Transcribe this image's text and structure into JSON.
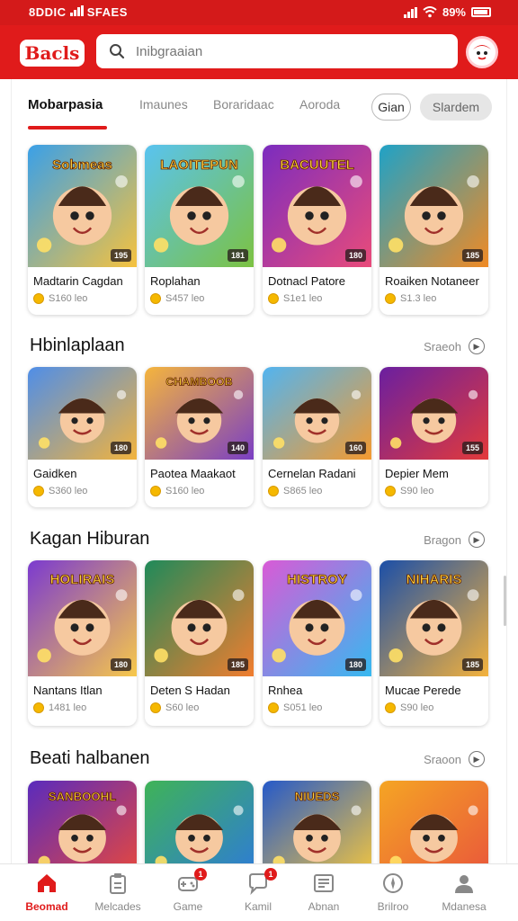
{
  "status_bar": {
    "left_text": "8DDIC",
    "carrier": "SFAES",
    "battery": "89%"
  },
  "app": {
    "logo": "Bacls",
    "search_placeholder": "Inibgraaian"
  },
  "tabs": [
    {
      "label": "Mobarpasia",
      "active": true
    },
    {
      "label": "Imaunes"
    },
    {
      "label": "Boraridaac"
    },
    {
      "label": "Aoroda"
    }
  ],
  "pills": [
    {
      "label": "Gian"
    },
    {
      "label": "Slardem"
    }
  ],
  "featured": {
    "cards": [
      {
        "title": "Madtarin Cagdan",
        "meta": "S160 leo",
        "badge": "195",
        "banner": "Sobmeas",
        "colors": [
          "#3aa0e8",
          "#f6c23e"
        ]
      },
      {
        "title": "Roplahan",
        "meta": "S457 leo",
        "badge": "181",
        "banner": "LAOITEPUN",
        "colors": [
          "#59c3f0",
          "#7cc242"
        ]
      },
      {
        "title": "Dotnacl Patore",
        "meta": "S1e1 leo",
        "badge": "180",
        "banner": "BACUUTEL",
        "colors": [
          "#7b2cbf",
          "#e94b7a"
        ]
      },
      {
        "title": "Roaiken Notaneer",
        "meta": "S1.3 leo",
        "badge": "185",
        "banner": "",
        "colors": [
          "#1fa2c7",
          "#f08a24"
        ]
      }
    ]
  },
  "sections": [
    {
      "title": "Hbinlaplaan",
      "see_all": "Sraeoh",
      "cards": [
        {
          "title": "Gaidken",
          "meta": "S360 leo",
          "badge": "180",
          "banner": "",
          "colors": [
            "#4f8ee8",
            "#f2b33d"
          ]
        },
        {
          "title": "Paotea Maakaot",
          "meta": "S160 leo",
          "badge": "140",
          "banner": "CHAMBOOB",
          "colors": [
            "#f5b53c",
            "#7a3fc4"
          ]
        },
        {
          "title": "Cernelan Radani",
          "meta": "S865 leo",
          "badge": "160",
          "banner": "",
          "colors": [
            "#52b4f0",
            "#f49a2f"
          ]
        },
        {
          "title": "Depier Mem",
          "meta": "S90 leo",
          "badge": "155",
          "banner": "",
          "colors": [
            "#6a1fa0",
            "#e33a3a"
          ]
        }
      ]
    },
    {
      "title": "Kagan Hiburan",
      "see_all": "Bragon",
      "cards": [
        {
          "title": "Nantans Itlan",
          "meta": "1481 leo",
          "badge": "180",
          "banner": "HOLIRAIS",
          "colors": [
            "#7b3ad0",
            "#f7c84a"
          ]
        },
        {
          "title": "Deten S Hadan",
          "meta": "S60 leo",
          "badge": "185",
          "banner": "",
          "colors": [
            "#1f8a5a",
            "#f17d2f"
          ]
        },
        {
          "title": "Rnhea",
          "meta": "S051 leo",
          "badge": "180",
          "banner": "HISTROY",
          "colors": [
            "#d95ad6",
            "#36b9f0"
          ]
        },
        {
          "title": "Mucae Perede",
          "meta": "S90 leo",
          "badge": "185",
          "banner": "NIHARIS",
          "colors": [
            "#1b4fa8",
            "#f4b23c"
          ]
        }
      ]
    },
    {
      "title": "Beati halbanen",
      "see_all": "Sraoon",
      "cards": [
        {
          "title": "",
          "meta": "",
          "badge": "",
          "banner": "SANBOOHL",
          "colors": [
            "#5a2bbd",
            "#e8483c"
          ]
        },
        {
          "title": "",
          "meta": "",
          "badge": "",
          "banner": "",
          "colors": [
            "#3fb357",
            "#2e7bd8"
          ]
        },
        {
          "title": "",
          "meta": "",
          "badge": "",
          "banner": "NIUEDS",
          "colors": [
            "#2559c9",
            "#f5c73e"
          ]
        },
        {
          "title": "",
          "meta": "",
          "badge": "",
          "banner": "",
          "colors": [
            "#f5a524",
            "#e9563b"
          ]
        }
      ]
    }
  ],
  "bottom_nav": [
    {
      "label": "Beomad",
      "icon": "home-icon",
      "active": true
    },
    {
      "label": "Melcades",
      "icon": "clipboard-icon"
    },
    {
      "label": "Game",
      "icon": "gamepad-icon",
      "badge": "1"
    },
    {
      "label": "Kamil",
      "icon": "chat-icon",
      "badge": "1"
    },
    {
      "label": "Abnan",
      "icon": "news-icon"
    },
    {
      "label": "Brilroo",
      "icon": "compass-icon"
    },
    {
      "label": "Mdanesa",
      "icon": "profile-icon"
    }
  ]
}
